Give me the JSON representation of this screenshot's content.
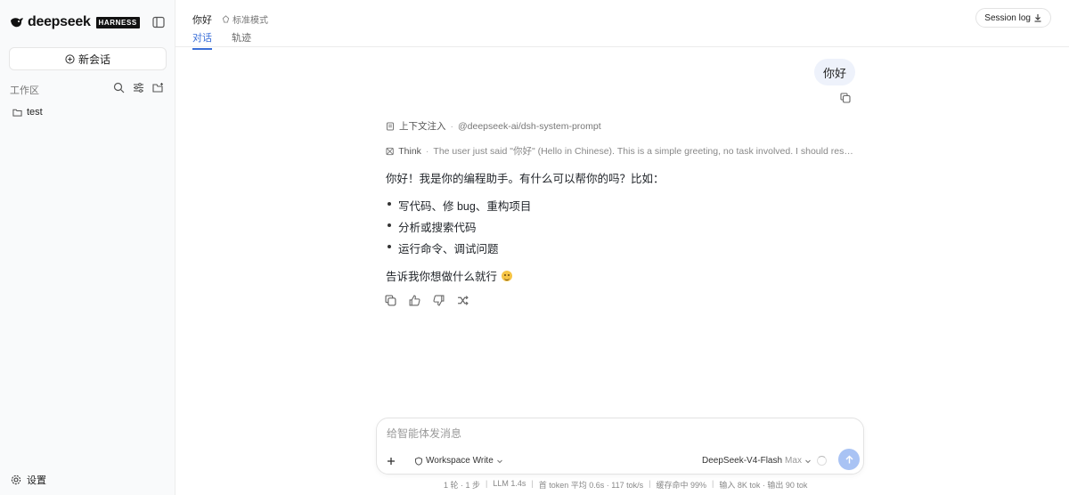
{
  "sidebar": {
    "brand_name": "deepseek",
    "brand_badge": "HARNESS",
    "new_chat_label": "新会话",
    "workspace_label": "工作区",
    "workspace_items": [
      "test"
    ],
    "settings_label": "设置"
  },
  "header": {
    "chat_title": "你好",
    "mode_label": "标准模式",
    "tabs": [
      {
        "label": "对话",
        "active": true
      },
      {
        "label": "轨迹",
        "active": false
      }
    ],
    "session_log_label": "Session log"
  },
  "conversation": {
    "user_message": "你好",
    "context_label": "上下文注入",
    "context_value": "@deepseek-ai/dsh-system-prompt",
    "think_label": "Think",
    "think_text": "The user just said \"你好\" (Hello in Chinese). This is a simple greeting, no task involved. I should respond in a...",
    "answer_intro": "你好！我是你的编程助手。有什么可以帮你的吗？比如：",
    "answer_items": [
      "写代码、修 bug、重构项目",
      "分析或搜索代码",
      "运行命令、调试问题"
    ],
    "answer_outro": "告诉我你想做什么就行"
  },
  "composer": {
    "placeholder": "给智能体发消息",
    "value": "",
    "mode_label": "Workspace Write",
    "model_label": "DeepSeek-V4-Flash",
    "model_level": "Max"
  },
  "stats": [
    "1 轮 · 1 步",
    "LLM 1.4s",
    "首 token 平均 0.6s · 117 tok/s",
    "缓存命中 99%",
    "输入 8K tok · 输出 90 tok"
  ],
  "colors": {
    "accent": "#3b6fd8",
    "send_button": "#a9c3f4",
    "user_bubble": "#eef2fb",
    "sidebar_bg": "#f9fafb"
  }
}
